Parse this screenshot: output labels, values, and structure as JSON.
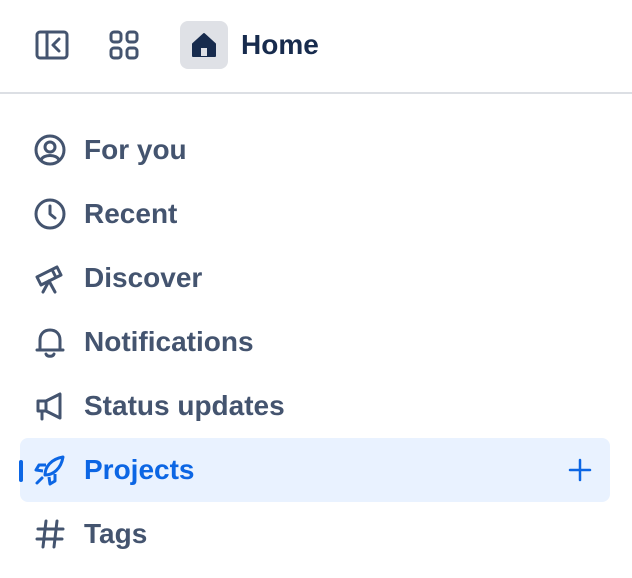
{
  "header": {
    "title": "Home",
    "sidebar_toggle_icon": "sidebar-collapse-icon",
    "apps_icon": "app-switcher-icon",
    "home_icon": "home-icon"
  },
  "nav": {
    "items": [
      {
        "label": "For you",
        "icon": "person-icon"
      },
      {
        "label": "Recent",
        "icon": "clock-icon"
      },
      {
        "label": "Discover",
        "icon": "telescope-icon"
      },
      {
        "label": "Notifications",
        "icon": "bell-icon"
      },
      {
        "label": "Status updates",
        "icon": "megaphone-icon"
      },
      {
        "label": "Projects",
        "icon": "rocket-icon",
        "active": true,
        "action_icon": "plus-icon"
      },
      {
        "label": "Tags",
        "icon": "hash-icon"
      }
    ]
  },
  "colors": {
    "accent": "#0c66e4",
    "active_bg": "#e9f2ff",
    "text": "#44546f",
    "title": "#172b4d",
    "divider": "#dcdfe4",
    "tile_bg": "#dfe1e6"
  }
}
